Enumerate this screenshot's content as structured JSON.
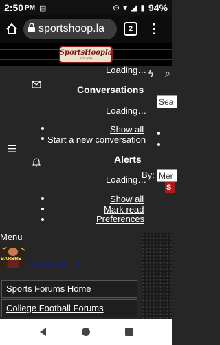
{
  "status_bar": {
    "time": "2:50",
    "ampm": "PM",
    "battery": "94%"
  },
  "browser": {
    "url": "sportshoop.la",
    "tab_count": "2"
  },
  "site": {
    "logo_text": "SportsHoopla",
    "logo_sub": "EST. 2009"
  },
  "panel": {
    "loading_top": "Loading…",
    "conversations": {
      "title": "Conversations",
      "loading": "Loading…",
      "show_all": "Show all",
      "start_new": "Start a new conversation"
    },
    "search_placeholder": "Sea",
    "alerts": {
      "title": "Alerts",
      "loading": "Loading…",
      "show_all": "Show all",
      "mark_read": "Mark read",
      "preferences": "Preferences"
    },
    "by_label": "By:",
    "member_placeholder": "Mer",
    "search_btn": "S"
  },
  "menu": {
    "label": "Menu"
  },
  "user": {
    "name": "Used 2 B Hu",
    "avatar_tag": "BARBRE"
  },
  "forums": [
    "Sports Forums Home",
    "College Football Forums"
  ]
}
